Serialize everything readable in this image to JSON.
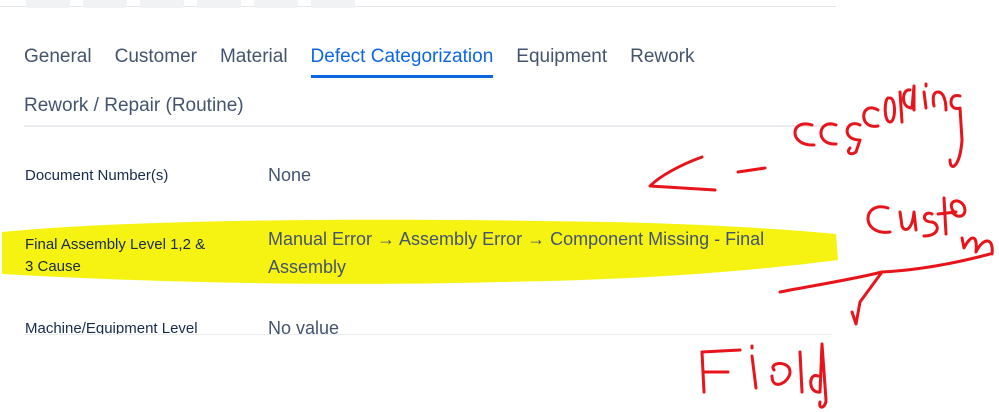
{
  "tabs": {
    "row1": [
      "General",
      "Customer",
      "Material",
      "Defect Categorization",
      "Equipment",
      "Rework"
    ],
    "row2": [
      "Rework / Repair (Routine)"
    ],
    "active": "Defect Categorization"
  },
  "fields": {
    "document_number": {
      "label": "Document Number(s)",
      "value": "None"
    },
    "final_assembly": {
      "label_line1": "Final Assembly Level 1,2 &",
      "label_line2": "3 Cause",
      "value_line1": "Manual Error → Assembly Error → Component Missing - Final",
      "value_line2": "Assembly"
    },
    "machine": {
      "label": "Machine/Equipment Level",
      "value": "No value"
    }
  },
  "annotation": {
    "word1": "cascading",
    "word2": "custom",
    "word3": "field",
    "ink_color": "#e8141b",
    "highlight_color": "#f6f313"
  }
}
